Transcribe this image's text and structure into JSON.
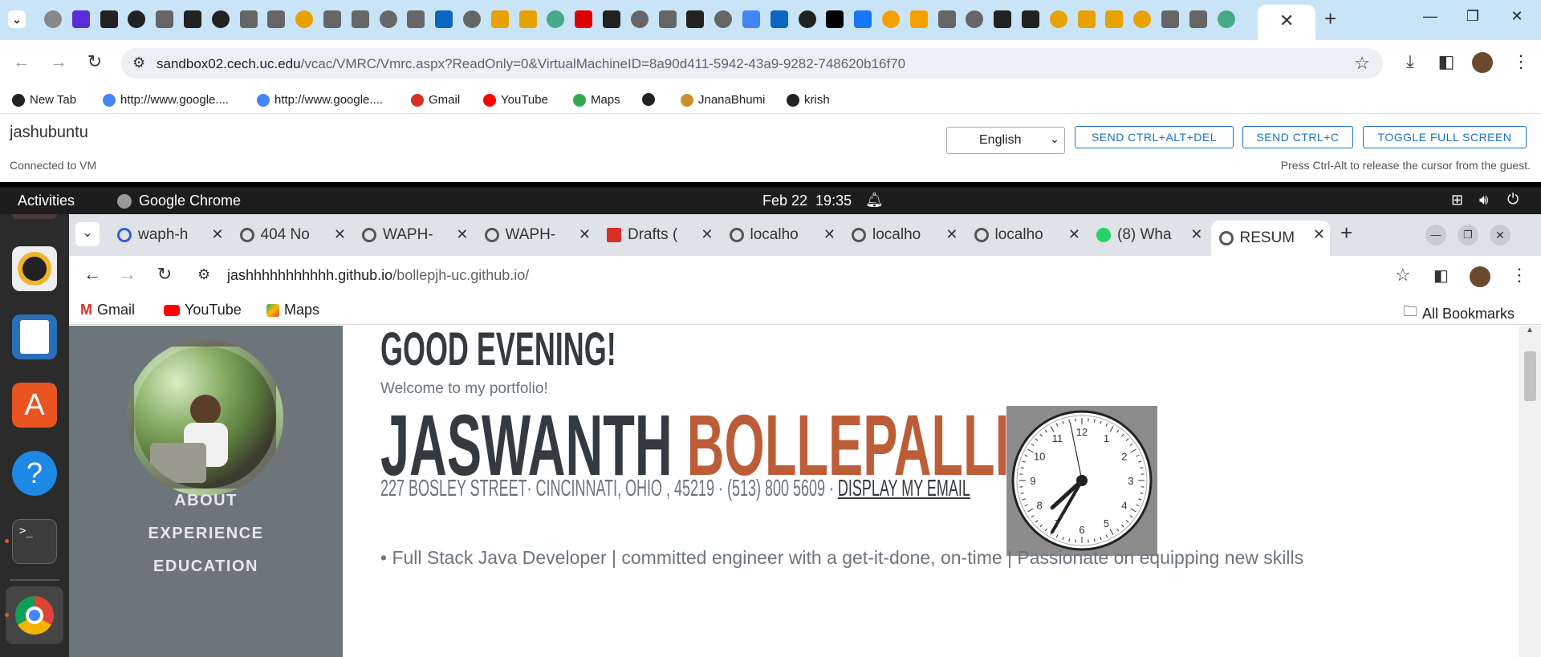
{
  "outer_browser": {
    "url_host": "sandbox02.cech.uc.edu",
    "url_rest": "/vcac/VMRC/Vmrc.aspx?ReadOnly=0&VirtualMachineID=8a90d411-5942-43a9-9282-748620b16f70",
    "bookmarks": [
      {
        "label": "New Tab",
        "icon": "globe-icon"
      },
      {
        "label": "http://www.google....",
        "icon": "google-icon"
      },
      {
        "label": "http://www.google....",
        "icon": "google-icon"
      },
      {
        "label": "Gmail",
        "icon": "gmail-icon"
      },
      {
        "label": "YouTube",
        "icon": "youtube-icon"
      },
      {
        "label": "Maps",
        "icon": "maps-icon"
      },
      {
        "label": "",
        "icon": "globe-icon"
      },
      {
        "label": "JnanaBhumi",
        "icon": "jnanabhumi-icon"
      },
      {
        "label": "krish",
        "icon": "globe-icon"
      }
    ]
  },
  "vmrc": {
    "vm_name": "jashubuntu",
    "status": "Connected to VM",
    "language": "English",
    "btn_cad": "SEND CTRL+ALT+DEL",
    "btn_ctrlc": "SEND CTRL+C",
    "btn_fullscreen": "TOGGLE FULL SCREEN",
    "hint": "Press Ctrl-Alt to release the cursor from the guest."
  },
  "gnome": {
    "activities": "Activities",
    "app_name": "Google Chrome",
    "datetime": "Feb 22  19:35"
  },
  "inner_browser": {
    "tabs": [
      {
        "label": "waph-h"
      },
      {
        "label": "404 No"
      },
      {
        "label": "WAPH-"
      },
      {
        "label": "WAPH-"
      },
      {
        "label": "Drafts ("
      },
      {
        "label": "localho"
      },
      {
        "label": "localho"
      },
      {
        "label": "localho"
      },
      {
        "label": "(8) Wha"
      },
      {
        "label": "RESUM"
      }
    ],
    "url_host": "jashhhhhhhhhhh.github.io",
    "url_rest": "/bollepjh-uc.github.io/",
    "bookmarks": [
      {
        "label": "Gmail"
      },
      {
        "label": "YouTube"
      },
      {
        "label": "Maps"
      }
    ],
    "all_bookmarks": "All Bookmarks"
  },
  "portfolio": {
    "greeting": "GOOD EVENING!",
    "welcome": "Welcome to my portfolio!",
    "first_name": "JASWANTH",
    "last_name": "BOLLEPALLI",
    "address": "227 BOSLEY STREET· CINCINNATI, OHIO , 45219 · (513) 800 5609 · ",
    "email_link": "DISPLAY MY EMAIL",
    "tagline": "• Full Stack Java Developer | committed engineer with a get-it-done, on-time | Passionate on equipping new skills",
    "nav": [
      "ABOUT",
      "EXPERIENCE",
      "EDUCATION"
    ],
    "clock_numbers": [
      "12",
      "1",
      "2",
      "3",
      "4",
      "5",
      "6",
      "7",
      "8",
      "9",
      "10",
      "11"
    ],
    "clock_time": {
      "hour": 7,
      "minute": 35
    }
  },
  "colors": {
    "accent_orange": "#bd5d38",
    "dark_text": "#343a40",
    "sidebar": "#6c7579",
    "vmrc_blue": "#1a73c4"
  }
}
